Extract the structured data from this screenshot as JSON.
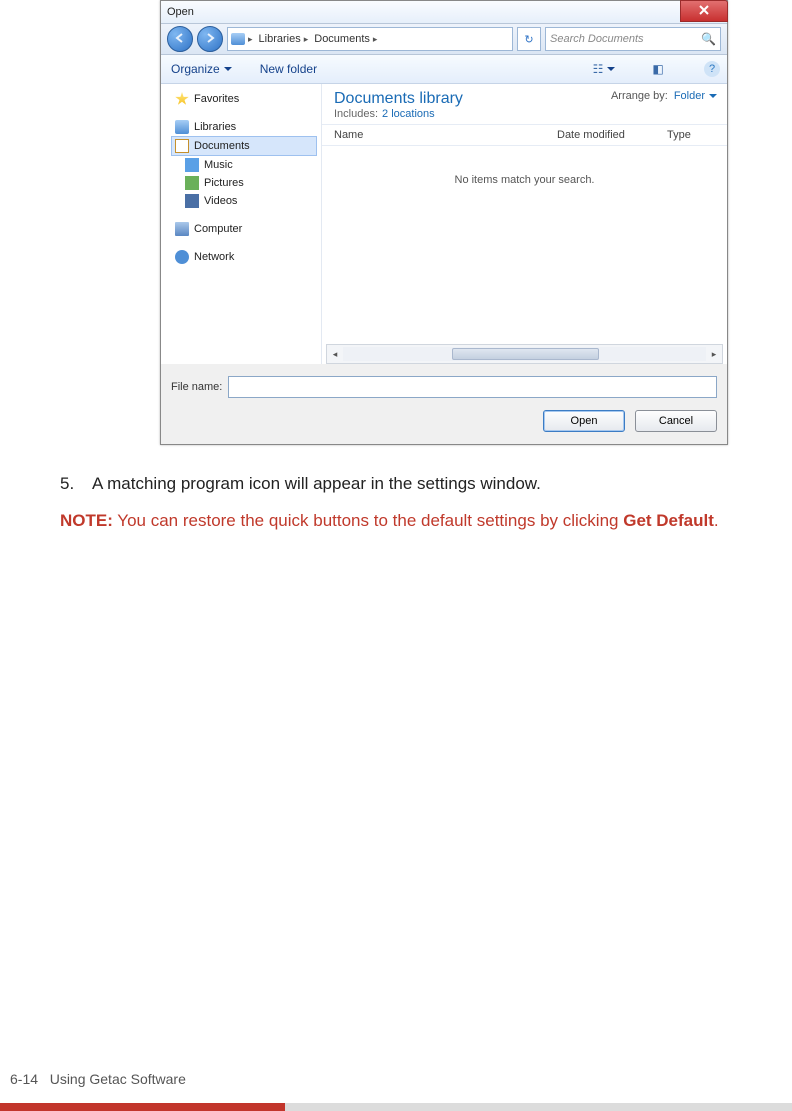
{
  "dialog": {
    "title": "Open",
    "breadcrumb": {
      "seg1": "Libraries",
      "seg2": "Documents"
    },
    "search_placeholder": "Search Documents",
    "toolbar": {
      "organize": "Organize",
      "new_folder": "New folder"
    },
    "nav": {
      "favorites": "Favorites",
      "libraries": "Libraries",
      "documents": "Documents",
      "music": "Music",
      "pictures": "Pictures",
      "videos": "Videos",
      "computer": "Computer",
      "network": "Network"
    },
    "lib_header": {
      "title": "Documents library",
      "includes_label": "Includes:",
      "locations": "2 locations",
      "arrange_label": "Arrange by:",
      "arrange_value": "Folder"
    },
    "columns": {
      "name": "Name",
      "date": "Date modified",
      "type": "Type"
    },
    "empty_message": "No items match your search.",
    "file_name_label": "File name:",
    "file_name_value": "",
    "open_btn": "Open",
    "cancel_btn": "Cancel"
  },
  "doc": {
    "step_num": "5.",
    "step_text": "A matching program icon will appear in the settings window.",
    "note_label": "NOTE:",
    "note_body_1": " You can restore the quick buttons to the default settings by clicking ",
    "note_button": "Get Default",
    "note_body_2": "."
  },
  "footer": {
    "page_num": "6-14",
    "chapter": "Using Getac Software"
  }
}
